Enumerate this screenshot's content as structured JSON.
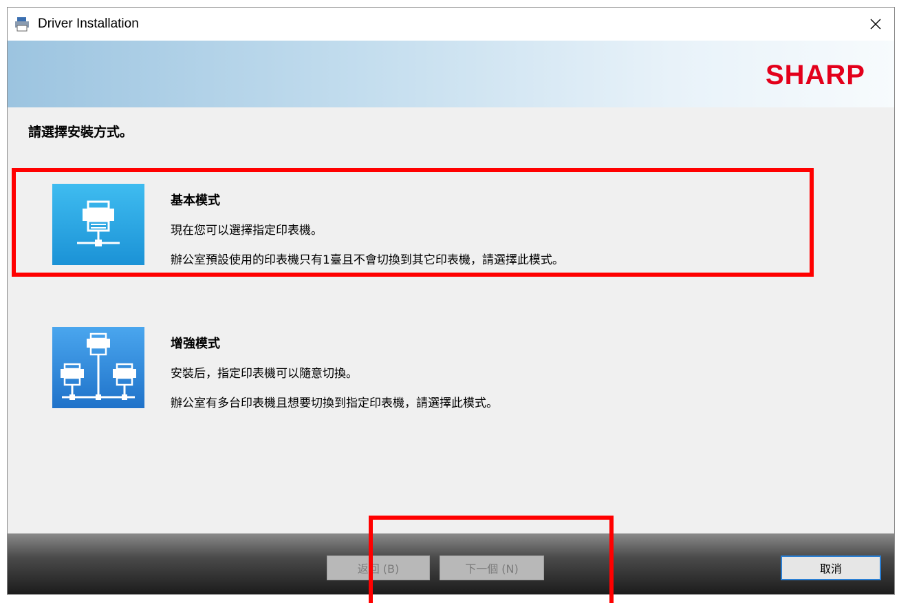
{
  "window": {
    "title": "Driver Installation",
    "app_icon": "printer-app-icon",
    "close_icon": "close-icon"
  },
  "banner": {
    "logo_text": "SHARP",
    "logo_color": "#e3001b"
  },
  "prompt": "請選擇安裝方式。",
  "options": [
    {
      "title": "基本模式",
      "line1": "現在您可以選擇指定印表機。",
      "line2": "辦公室預設使用的印表機只有1臺且不會切換到其它印表機，請選擇此模式。",
      "icon": "single-printer-icon"
    },
    {
      "title": "增強模式",
      "line1": "安裝后，指定印表機可以隨意切換。",
      "line2": "辦公室有多台印表機且想要切換到指定印表機，請選擇此模式。",
      "icon": "multi-printer-network-icon"
    }
  ],
  "buttons": {
    "back": "返回 (B)",
    "next": "下一個 (N)",
    "cancel": "取消"
  },
  "colors": {
    "highlight": "#ff0000",
    "accent": "#2a7fd4"
  }
}
